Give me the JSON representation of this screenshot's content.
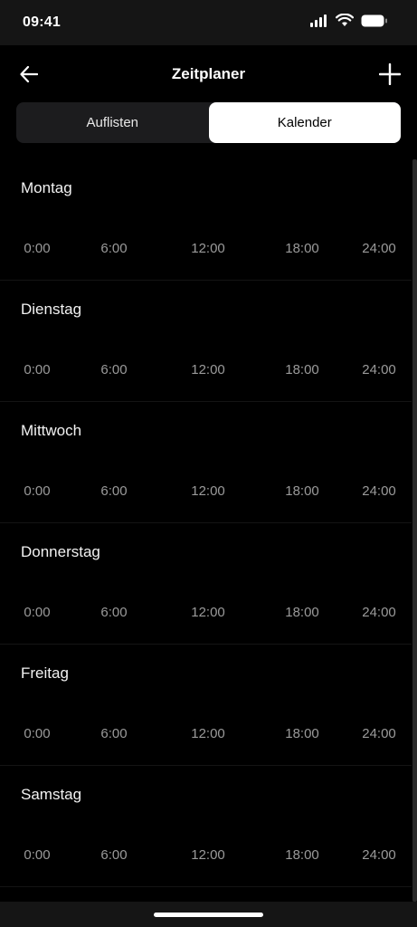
{
  "status_bar": {
    "time": "09:41"
  },
  "header": {
    "title": "Zeitplaner"
  },
  "tabs": [
    {
      "label": "Auflisten",
      "active": false
    },
    {
      "label": "Kalender",
      "active": true
    }
  ],
  "days": [
    {
      "name": "Montag",
      "ticks": [
        "0:00",
        "6:00",
        "12:00",
        "18:00",
        "24:00"
      ]
    },
    {
      "name": "Dienstag",
      "ticks": [
        "0:00",
        "6:00",
        "12:00",
        "18:00",
        "24:00"
      ]
    },
    {
      "name": "Mittwoch",
      "ticks": [
        "0:00",
        "6:00",
        "12:00",
        "18:00",
        "24:00"
      ]
    },
    {
      "name": "Donnerstag",
      "ticks": [
        "0:00",
        "6:00",
        "12:00",
        "18:00",
        "24:00"
      ]
    },
    {
      "name": "Freitag",
      "ticks": [
        "0:00",
        "6:00",
        "12:00",
        "18:00",
        "24:00"
      ]
    },
    {
      "name": "Samstag",
      "ticks": [
        "0:00",
        "6:00",
        "12:00",
        "18:00",
        "24:00"
      ]
    }
  ]
}
